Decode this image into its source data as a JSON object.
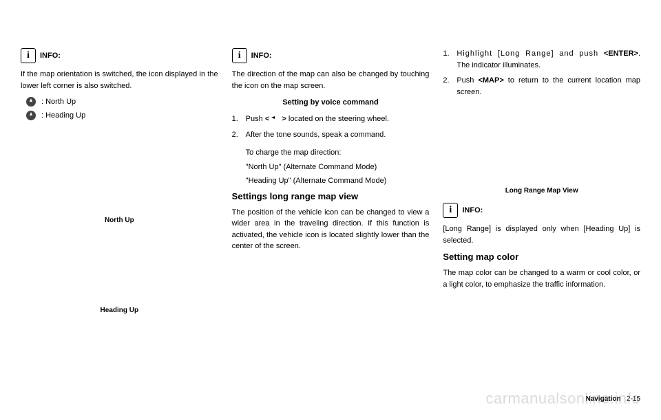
{
  "col1": {
    "info_label": "INFO:",
    "info_text": "If the map orientation is switched, the icon displayed in the lower left corner is also switched.",
    "north_up": ": North Up",
    "heading_up": ": Heading Up",
    "caption1": "North Up",
    "caption2": "Heading Up"
  },
  "col2": {
    "info_label": "INFO:",
    "info_text": "The direction of the map can also be changed by touching the icon on the map screen.",
    "voice_heading": "Setting by voice command",
    "step1_pre": "Push ",
    "step1_bold": "<",
    "step1_post": "located on the steering wheel.",
    "step1_close": ">",
    "step2": "After the tone sounds, speak a command.",
    "step2_sub1": "To charge the map direction:",
    "step2_sub2": "\"North Up\" (Alternate Command Mode)",
    "step2_sub3": "\"Heading Up\" (Alternate Command Mode)",
    "section_heading": "Settings long range map view",
    "section_text": "The position of the vehicle icon can be changed to view a wider area in the traveling direction. If this function is activated, the vehicle icon is located slightly lower than the center of the screen."
  },
  "col3": {
    "step1_pre": "Highlight [Long Range] and push ",
    "step1_bold": "<ENTER>",
    "step1_post": ". The indicator illuminates.",
    "step2_pre": "Push ",
    "step2_bold": "<MAP>",
    "step2_post": " to return to the current location map screen.",
    "caption": "Long Range Map View",
    "info_label": "INFO:",
    "info_text": "[Long Range] is displayed only when [Heading Up] is selected.",
    "section_heading": "Setting map color",
    "section_text": "The map color can be changed to a warm or cool color, or a light color, to emphasize the traffic information."
  },
  "footer": {
    "nav": "Navigation",
    "page": "2-15"
  },
  "watermark": "carmanualsonline.info"
}
